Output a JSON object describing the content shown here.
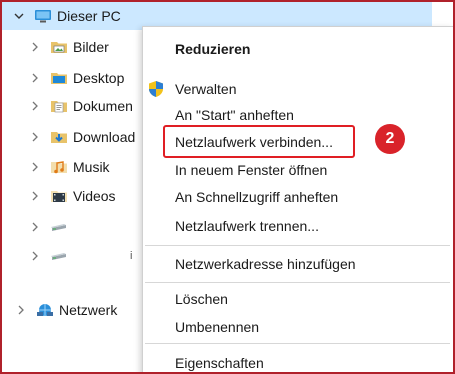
{
  "tree": {
    "this_pc": {
      "label": "Dieser PC",
      "expanded": true,
      "icon": "computer-icon"
    },
    "items": [
      {
        "label": "Bilder",
        "icon": "pictures-folder-icon"
      },
      {
        "label": "Desktop",
        "icon": "desktop-folder-icon"
      },
      {
        "label": "Dokumen",
        "icon": "documents-folder-icon"
      },
      {
        "label": "Download",
        "icon": "downloads-folder-icon"
      },
      {
        "label": "Musik",
        "icon": "music-folder-icon"
      },
      {
        "label": "Videos",
        "icon": "videos-folder-icon"
      },
      {
        "label": "",
        "icon": "drive-icon"
      },
      {
        "label": "",
        "icon": "drive-icon",
        "extra": "i"
      }
    ],
    "network": {
      "label": "Netzwerk",
      "icon": "network-icon"
    }
  },
  "context_menu": {
    "items": [
      {
        "label": "Reduzieren",
        "bold": true
      },
      {
        "label": "Verwalten",
        "icon": "admin-shield-icon"
      },
      {
        "label": "An \"Start\" anheften"
      },
      {
        "label": "Netzlaufwerk verbinden..."
      },
      {
        "label": "In neuem Fenster öffnen"
      },
      {
        "label": "An Schnellzugriff anheften"
      },
      {
        "label": "Netzlaufwerk trennen..."
      },
      {
        "label": "Netzwerkadresse hinzufügen"
      },
      {
        "label": "Löschen"
      },
      {
        "label": "Umbenennen"
      },
      {
        "label": "Eigenschaften"
      }
    ]
  },
  "annotation": {
    "step": "2",
    "color": "#d9232a"
  },
  "colors": {
    "selection": "#cce8ff",
    "frame": "#b0212b"
  }
}
